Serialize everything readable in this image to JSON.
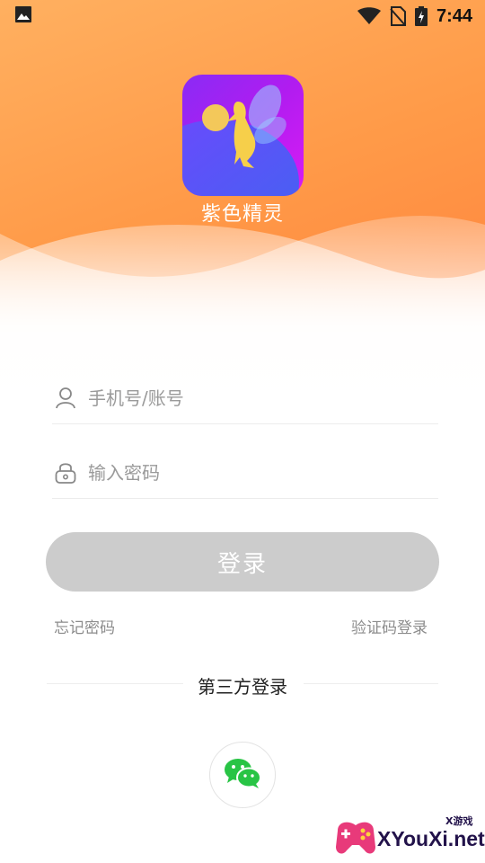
{
  "status_bar": {
    "time": "7:44"
  },
  "app": {
    "name": "紫色精灵"
  },
  "form": {
    "account_placeholder": "手机号/账号",
    "password_placeholder": "输入密码",
    "login_label": "登录",
    "forgot_password": "忘记密码",
    "sms_login": "验证码登录"
  },
  "third_party": {
    "title": "第三方登录",
    "wechat_icon": "wechat-icon"
  },
  "watermark": {
    "brand": "XYouXi.net",
    "small": "X游戏"
  },
  "colors": {
    "header_gradient_start": "#ffb060",
    "header_gradient_end": "#ff7c3a",
    "login_button": "#cccccc",
    "wechat_green": "#28c445",
    "app_icon_purple": "#b11cf0"
  }
}
